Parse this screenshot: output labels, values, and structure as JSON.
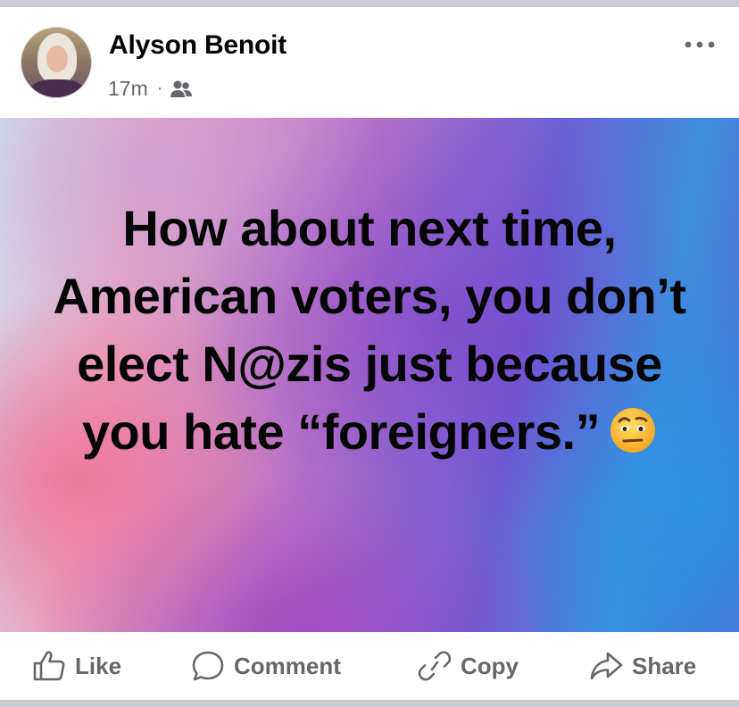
{
  "post": {
    "author": "Alyson Benoit",
    "time": "17m",
    "separator": "·",
    "audience_icon": "friends-icon",
    "more_icon": "more-horizontal-icon",
    "text": "How about next time, American voters, you don’t elect N@zis just because you hate “foreigners.”",
    "emoji": "face-with-raised-eyebrow-emoji"
  },
  "actions": {
    "like": "Like",
    "comment": "Comment",
    "copy": "Copy",
    "share": "Share"
  },
  "colors": {
    "text_primary": "#050505",
    "text_secondary": "#65676b",
    "page_background": "#c9ccd1"
  }
}
